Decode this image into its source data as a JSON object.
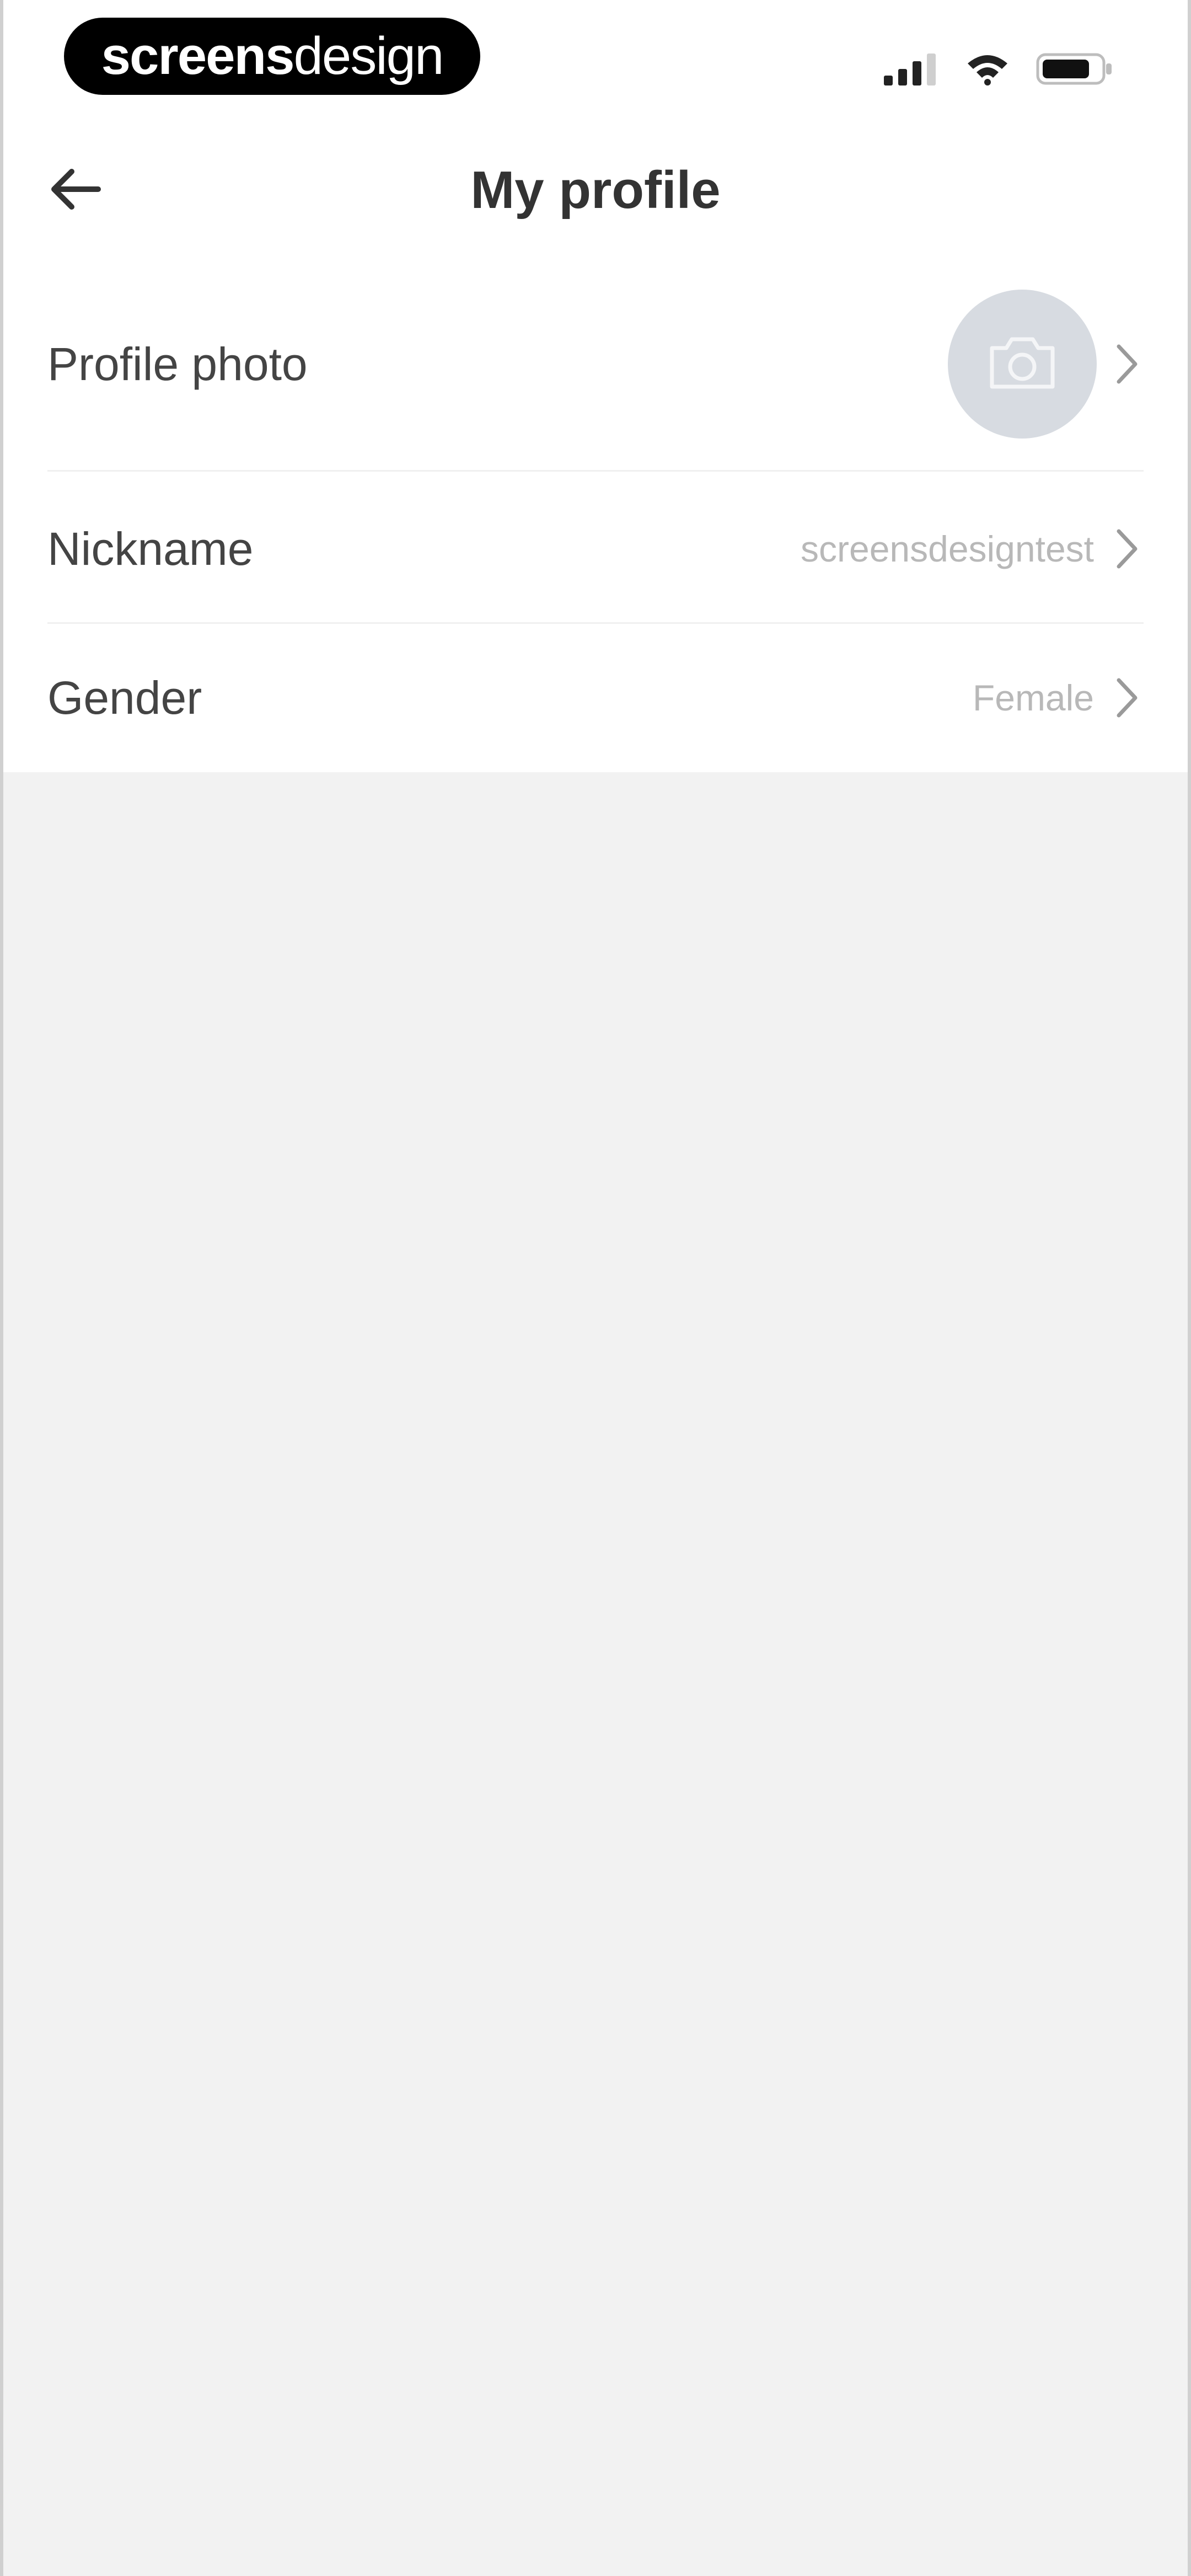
{
  "status_bar": {
    "brand_bold": "screens",
    "brand_light": "design",
    "icons": [
      "signal-icon",
      "wifi-icon",
      "battery-icon"
    ]
  },
  "nav": {
    "title": "My profile",
    "back_icon": "arrow-left-icon"
  },
  "rows": {
    "photo": {
      "label": "Profile photo",
      "icon": "camera-icon"
    },
    "nickname": {
      "label": "Nickname",
      "value": "screensdesigntest"
    },
    "gender": {
      "label": "Gender",
      "value": "Female"
    }
  },
  "colors": {
    "background": "#f2f2f2",
    "surface": "#ffffff",
    "title_text": "#333333",
    "label_text": "#444444",
    "value_text": "#b8b8b8",
    "avatar_bg": "#d7dbe1"
  }
}
